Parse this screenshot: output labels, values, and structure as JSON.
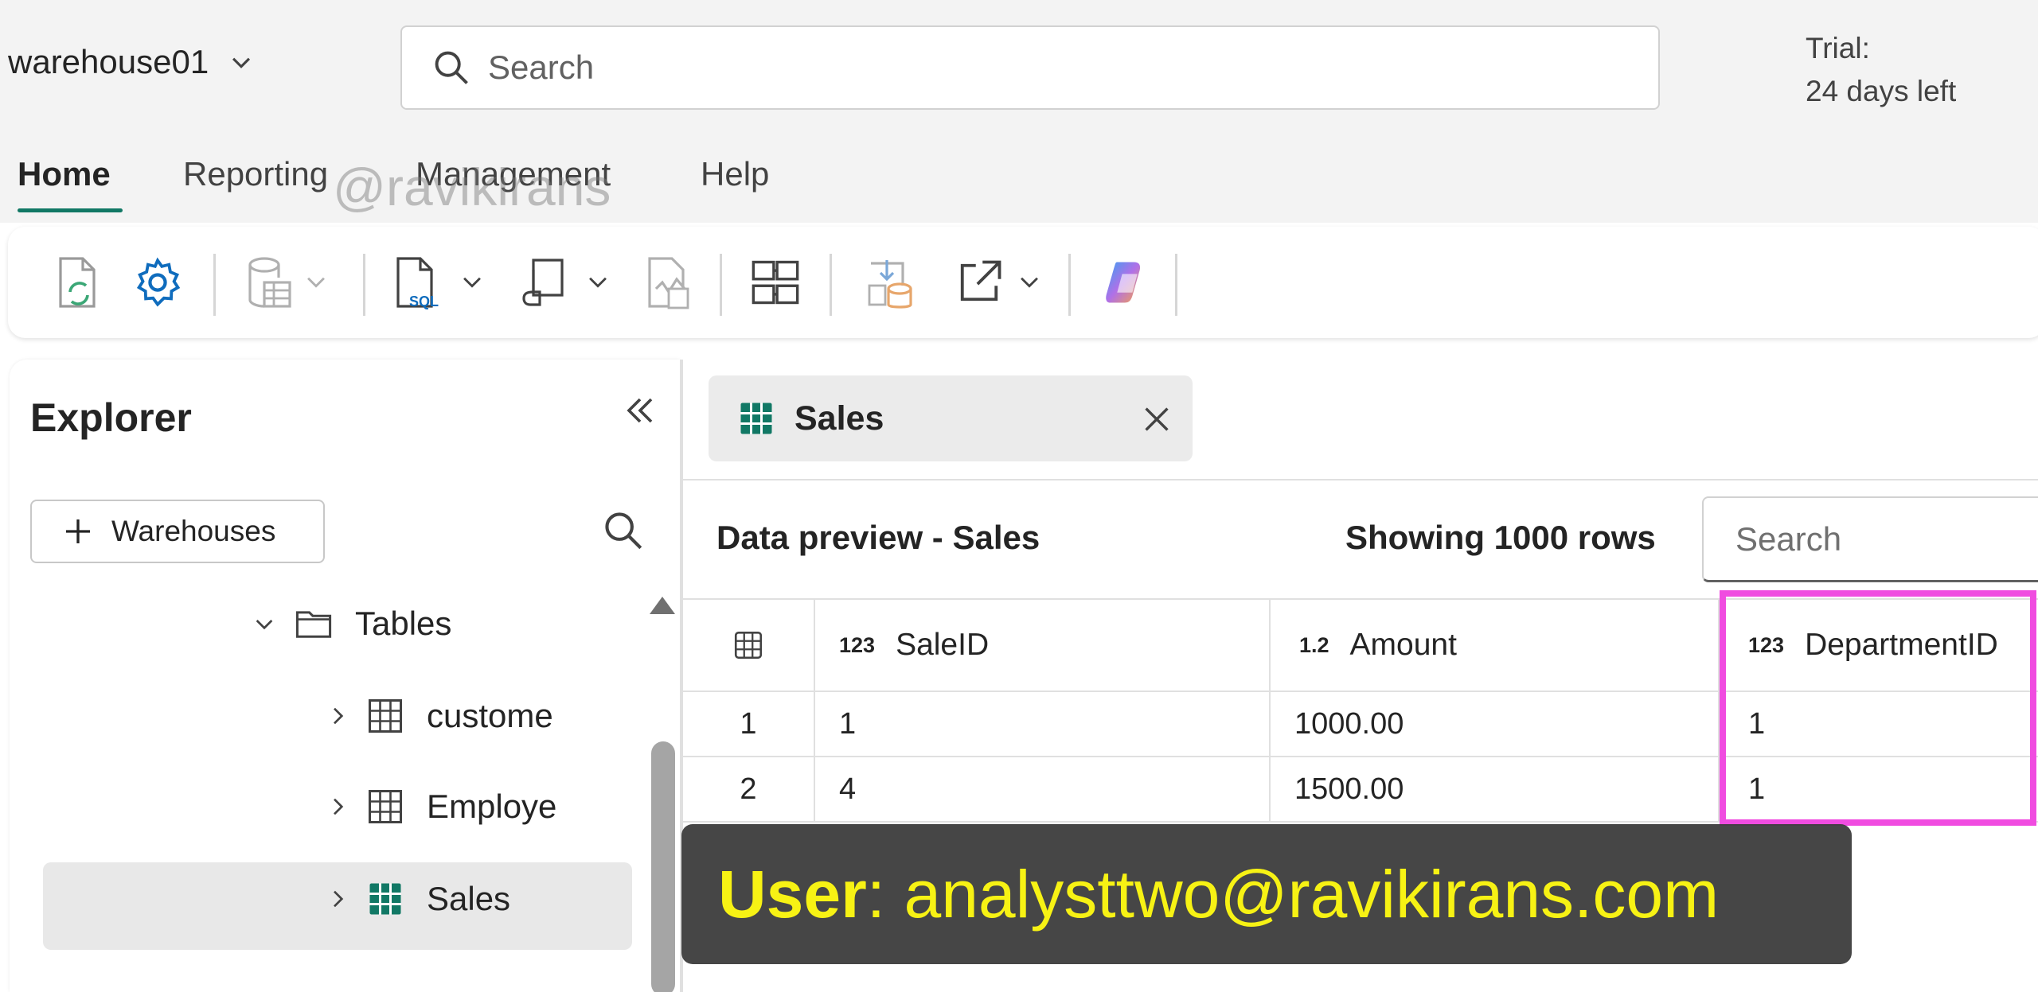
{
  "header": {
    "workspace": "warehouse01",
    "search_placeholder": "Search",
    "trial_line1": "Trial:",
    "trial_line2": "24 days left"
  },
  "ribbon": {
    "tabs": [
      "Home",
      "Reporting",
      "Management",
      "Help"
    ],
    "active_tab": "Home",
    "watermark": "@ravikirans"
  },
  "toolbar": {
    "buttons": [
      "refresh-icon",
      "settings-icon",
      "database-table-icon",
      "sql-query-icon",
      "visual-query-icon",
      "compare-icon",
      "model-layout-icon",
      "load-data-icon",
      "share-icon",
      "copilot-icon"
    ]
  },
  "explorer": {
    "title": "Explorer",
    "add_button": "Warehouses",
    "tree": {
      "folder": "Tables",
      "items": [
        "custome",
        "Employe",
        "Sales"
      ],
      "selected": "Sales"
    }
  },
  "main": {
    "tab_label": "Sales",
    "preview_title": "Data preview - Sales",
    "rows_count": "Showing 1000 rows",
    "search_placeholder": "Search",
    "columns": [
      {
        "type": "123",
        "name": "SaleID"
      },
      {
        "type": "1.2",
        "name": "Amount"
      },
      {
        "type": "123",
        "name": "DepartmentID"
      }
    ],
    "rows": [
      {
        "index": "1",
        "SaleID": "1",
        "Amount": "1000.00",
        "DepartmentID": "1"
      },
      {
        "index": "2",
        "SaleID": "4",
        "Amount": "1500.00",
        "DepartmentID": "1"
      }
    ]
  },
  "caption": {
    "label": "User",
    "separator": ":",
    "value": " analysttwo@ravikirans.com"
  },
  "colors": {
    "accent": "#117865",
    "highlight": "#f04ce0",
    "caption_text": "#f7f214",
    "caption_bg": "#3c3c3c",
    "settings_icon": "#0f6cbd"
  }
}
